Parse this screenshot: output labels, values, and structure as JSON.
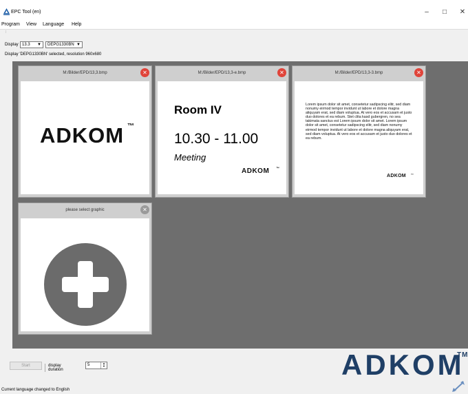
{
  "window": {
    "title": "EPC Tool (en)",
    "minimize_glyph": "–",
    "maximize_glyph": "□",
    "close_glyph": "✕"
  },
  "menu": {
    "items": [
      "Program",
      "View",
      "Language",
      "Help"
    ]
  },
  "toolbar": {
    "display_label": "Display",
    "size_value": "13.3",
    "model_value": "DEPG1330BN",
    "status_text": "Display 'DEPG1330BN' selected, resolution 960x680"
  },
  "tiles": [
    {
      "path": "M:/Bilder/EPD/13,3.bmp",
      "close_glyph": "✕",
      "logo": "ADKOM",
      "tm": "™"
    },
    {
      "path": "M:/Bilder/EPD/13,3-e.bmp",
      "close_glyph": "✕",
      "room": "Room IV",
      "time": "10.30 - 11.00",
      "subject": "Meeting",
      "logo": "ADKOM",
      "tm": "™"
    },
    {
      "path": "M:/Bilder/EPD/13,3-3.bmp",
      "close_glyph": "✕",
      "text": "Lorem ipsum dolor sit amet, consetetur sadipscing elitr, sed diam nonumy eirmod tempor invidunt ut labore et dolore magna aliquyam erat, sed diam voluptua. At vero eos et accusam et justo duo dolores et ea rebum. Stet clita kasd gubergren, no sea takimata sanctus est Lorem ipsum dolor sit amet. Lorem ipsum dolor sit amet, consetetur sadipscing elitr, sed diam nonumy eirmod tempor invidunt ut labore et dolore magna aliquyam erat, sed diam voluptua. At vero eos et accusam et justo duo dolores et ea rebum.",
      "logo": "ADKOM",
      "tm": "™"
    },
    {
      "path": "please select graphic",
      "close_glyph": "✕"
    }
  ],
  "bottom": {
    "start_label": "Start",
    "duration_label": "display duration",
    "duration_value": "5",
    "logo": "ADKOM",
    "tm": "TM"
  },
  "statusbar": {
    "message": "Current language changed to English"
  },
  "colors": {
    "workarea": "#6e6e6e",
    "close_red": "#e0443a",
    "logo_blue": "#1f3f66"
  }
}
